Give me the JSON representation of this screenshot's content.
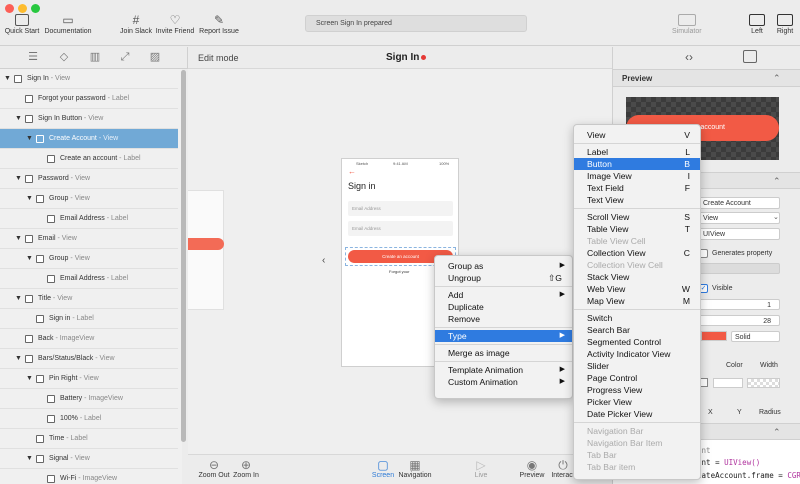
{
  "toolbar": {
    "traffic_colors": [
      "#fc5f57",
      "#fdbc2e",
      "#28c840"
    ],
    "buttons": [
      {
        "label": "Quick Start",
        "icon": "play-icon"
      },
      {
        "label": "Documentation",
        "icon": "doc-icon"
      },
      {
        "label": "Join Slack",
        "icon": "slack-icon"
      },
      {
        "label": "Invite Friend",
        "icon": "heart-icon"
      },
      {
        "label": "Report Issue",
        "icon": "brush-icon"
      }
    ],
    "status": "Screen Sign In prepared",
    "simulator": "Simulator",
    "left": "Left",
    "right": "Right"
  },
  "tree": {
    "rows": [
      {
        "label": "Sign In",
        "type": "View",
        "arrow": "▼",
        "icon": "box"
      },
      {
        "label": "Forgot your password",
        "type": "Label",
        "arrow": "",
        "icon": "label"
      },
      {
        "label": "Sign In Button",
        "type": "View",
        "arrow": "▼",
        "icon": "box"
      },
      {
        "label": "Create Account",
        "type": "View",
        "arrow": "▼",
        "icon": "box"
      },
      {
        "label": "Create an account",
        "type": "Label",
        "arrow": "",
        "icon": "label"
      },
      {
        "label": "Password",
        "type": "View",
        "arrow": "▼",
        "icon": "box"
      },
      {
        "label": "Group",
        "type": "View",
        "arrow": "▼",
        "icon": "box"
      },
      {
        "label": "Email Address",
        "type": "Label",
        "arrow": "",
        "icon": "label"
      },
      {
        "label": "Email",
        "type": "View",
        "arrow": "▼",
        "icon": "box"
      },
      {
        "label": "Group",
        "type": "View",
        "arrow": "▼",
        "icon": "box"
      },
      {
        "label": "Email Address",
        "type": "Label",
        "arrow": "",
        "icon": "label"
      },
      {
        "label": "Title",
        "type": "View",
        "arrow": "▼",
        "icon": "box"
      },
      {
        "label": "Sign in",
        "type": "Label",
        "arrow": "",
        "icon": "label"
      },
      {
        "label": "Back",
        "type": "ImageView",
        "arrow": "",
        "icon": "image"
      },
      {
        "label": "Bars/Status/Black",
        "type": "View",
        "arrow": "▼",
        "icon": "box"
      },
      {
        "label": "Pin Right",
        "type": "View",
        "arrow": "▼",
        "icon": "box"
      },
      {
        "label": "Battery",
        "type": "ImageView",
        "arrow": "",
        "icon": "image"
      },
      {
        "label": "100%",
        "type": "Label",
        "arrow": "",
        "icon": "label"
      },
      {
        "label": "Time",
        "type": "Label",
        "arrow": "",
        "icon": "label"
      },
      {
        "label": "Signal",
        "type": "View",
        "arrow": "▼",
        "icon": "box"
      },
      {
        "label": "Wi-Fi",
        "type": "ImageView",
        "arrow": "",
        "icon": "image"
      }
    ]
  },
  "canvas": {
    "mode": "Edit mode",
    "screen_title": "Sign In",
    "phone": {
      "carrier": "Sketch",
      "time": "9:41 AM",
      "battery": "100%",
      "heading": "Sign in",
      "email_placeholder": "Email Address",
      "password_placeholder": "Email Address",
      "button": "Create an account",
      "forgot": "Forgot your"
    }
  },
  "bottom": {
    "zoom_out": "Zoom Out",
    "zoom_in": "Zoom In",
    "screen": "Screen",
    "navigation": "Navigation",
    "live": "Live",
    "preview": "Preview",
    "interact": "Interact"
  },
  "context_menu": {
    "items": [
      {
        "label": "Group as",
        "sub": true
      },
      {
        "label": "Ungroup",
        "shortcut": "⇧G"
      },
      {
        "sep": true
      },
      {
        "label": "Add",
        "sub": true
      },
      {
        "label": "Duplicate"
      },
      {
        "label": "Remove"
      },
      {
        "sep": true
      },
      {
        "label": "Type",
        "sub": true,
        "highlight": true
      },
      {
        "sep": true
      },
      {
        "label": "Merge as image"
      },
      {
        "sep": true
      },
      {
        "label": "Template Animation",
        "sub": true
      },
      {
        "label": "Custom Animation",
        "sub": true
      }
    ]
  },
  "type_menu": {
    "items": [
      {
        "label": "View",
        "shortcut": "V"
      },
      {
        "sep": true
      },
      {
        "label": "Label",
        "shortcut": "L"
      },
      {
        "label": "Button",
        "shortcut": "B",
        "highlight": true
      },
      {
        "label": "Image View",
        "shortcut": "I"
      },
      {
        "label": "Text Field",
        "shortcut": "F"
      },
      {
        "label": "Text View"
      },
      {
        "sep": true
      },
      {
        "label": "Scroll View",
        "shortcut": "S"
      },
      {
        "label": "Table View",
        "shortcut": "T"
      },
      {
        "label": "Table View Cell",
        "disabled": true
      },
      {
        "label": "Collection View",
        "shortcut": "C"
      },
      {
        "label": "Collection View Cell",
        "disabled": true
      },
      {
        "label": "Stack View"
      },
      {
        "label": "Web View",
        "shortcut": "W"
      },
      {
        "label": "Map View",
        "shortcut": "M"
      },
      {
        "sep": true
      },
      {
        "label": "Switch"
      },
      {
        "label": "Search Bar"
      },
      {
        "label": "Segmented Control"
      },
      {
        "label": "Activity Indicator View"
      },
      {
        "label": "Slider"
      },
      {
        "label": "Page Control"
      },
      {
        "label": "Progress View"
      },
      {
        "label": "Picker View"
      },
      {
        "label": "Date Picker View"
      },
      {
        "sep": true
      },
      {
        "label": "Navigation Bar",
        "disabled": true
      },
      {
        "label": "Navigation Bar Item",
        "disabled": true
      },
      {
        "label": "Tab Bar",
        "disabled": true
      },
      {
        "label": "Tab Bar item",
        "disabled": true
      }
    ]
  },
  "inspector": {
    "preview_title": "Preview",
    "preview_button": "an account",
    "name_value": "Create Account",
    "class_value": "View",
    "uiview_value": "UIView",
    "generates_property": "Generates property",
    "visible": "Visible",
    "val1": "1",
    "val2": "28",
    "border_style": "Solid",
    "color_label": "Color",
    "width_label": "Width",
    "x_label": "X",
    "y_label": "Y",
    "radius_label": "Radius",
    "code_line1": "count",
    "code_line2_prefix": "count = ",
    "code_line2_class": "UIView()",
    "code_line3_prefix": "createAccount.frame = ",
    "code_line3_class": "CGRect"
  },
  "colors": {
    "accent": "#2f7be0",
    "selection": "#71a9d6",
    "cta": "#f25a45",
    "status_dot": "#e53935"
  }
}
